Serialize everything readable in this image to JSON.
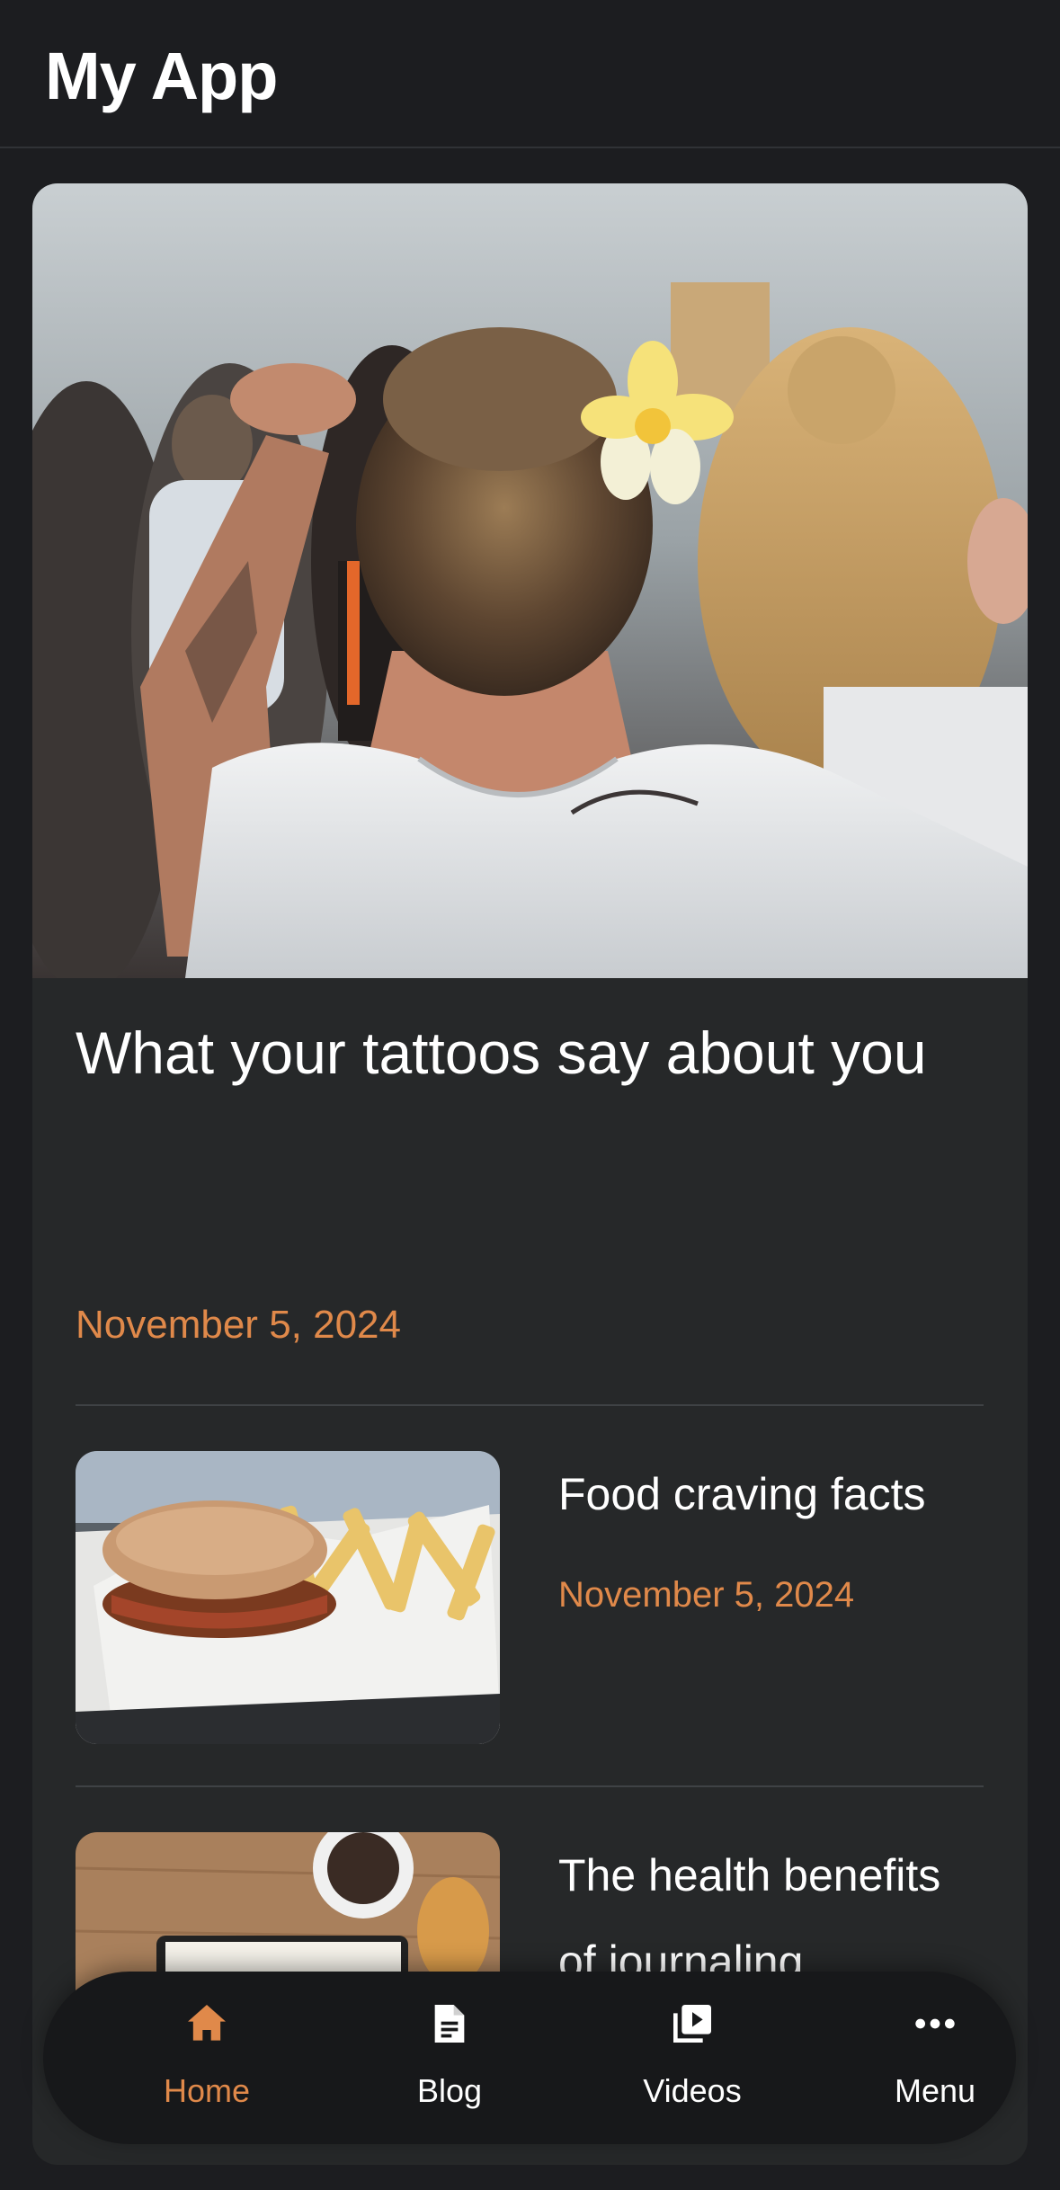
{
  "app": {
    "title": "My App"
  },
  "featured": {
    "title": "What your tattoos say about you",
    "date": "November 5, 2024",
    "image_icon": "photo-woman-tattoo"
  },
  "articles": [
    {
      "title": "Food craving facts",
      "date": "November 5, 2024",
      "image_icon": "photo-burger-fries"
    },
    {
      "title": "The health benefits of journaling",
      "date": "",
      "image_icon": "photo-journal-coffee"
    }
  ],
  "nav": {
    "items": [
      {
        "label": "Home",
        "icon": "home-icon",
        "active": true
      },
      {
        "label": "Blog",
        "icon": "document-icon",
        "active": false
      },
      {
        "label": "Videos",
        "icon": "video-library-icon",
        "active": false
      },
      {
        "label": "Menu",
        "icon": "more-horizontal-icon",
        "active": false
      }
    ]
  },
  "colors": {
    "background": "#1c1d20",
    "card": "#262829",
    "accent": "#e0894a",
    "nav_background": "#17181a"
  }
}
